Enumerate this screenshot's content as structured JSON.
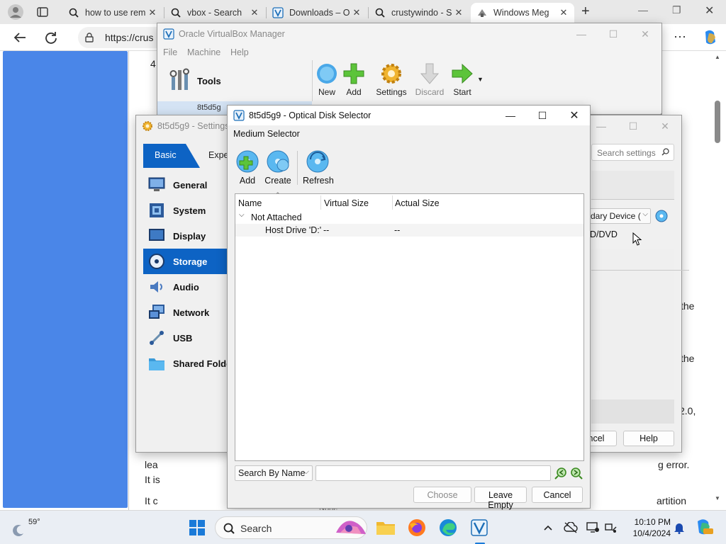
{
  "browser": {
    "tabs": [
      {
        "label": "how to use rem",
        "icon": "search-icon"
      },
      {
        "label": "vbox - Search",
        "icon": "search-icon"
      },
      {
        "label": "Downloads – O",
        "icon": "vbox-icon"
      },
      {
        "label": "crustywindo - S",
        "icon": "search-icon"
      },
      {
        "label": "Windows Meg",
        "icon": "page-icon"
      }
    ],
    "address": "https://crus",
    "new_tab": "+"
  },
  "webpage": {
    "fragments": {
      "top_num": "4",
      "the1": "the",
      "the2": "the",
      "v20": "2.0,",
      "lea": "lea",
      "it_is": "It is",
      "it_c": "It c",
      "g_error": "g error.",
      "artition": "artition",
      "none": "None"
    }
  },
  "vbox_manager": {
    "title": "Oracle VirtualBox Manager",
    "menu": [
      "File",
      "Machine",
      "Help"
    ],
    "tools_label": "Tools",
    "vm_name": "8t5d5g",
    "toolbar": [
      "New",
      "Add",
      "Settings",
      "Discard",
      "Start"
    ]
  },
  "settings": {
    "title": "8t5d5g9 - Settings",
    "tab_basic": "Basic",
    "tab_expert": "Exper",
    "search_placeholder": "Search settings",
    "sections": [
      "General",
      "System",
      "Display",
      "Storage",
      "Audio",
      "Network",
      "USB",
      "Shared Folder"
    ],
    "active_section": "Storage",
    "secondary_device": "dary Device (",
    "optical": "D/DVD",
    "cancel_label": "ncel",
    "help_label": "Help"
  },
  "disk_selector": {
    "title": "8t5d5g9 - Optical Disk Selector",
    "medium_selector": "Medium Selector",
    "toolbar": [
      "Add",
      "Create",
      "Refresh"
    ],
    "columns": [
      "Name",
      "Virtual Size",
      "Actual Size"
    ],
    "group": "Not Attached",
    "rows": [
      {
        "name": "Host Drive 'D:'",
        "virtual_size": "--",
        "actual_size": "--"
      }
    ],
    "search_mode": "Search By Name",
    "search_value": "",
    "buttons": {
      "choose": "Choose",
      "leave_empty": "Leave Empty",
      "cancel": "Cancel"
    }
  },
  "taskbar": {
    "weather_temp": "59°",
    "search_label": "Search",
    "time": "10:10 PM",
    "date": "10/4/2024"
  },
  "colors": {
    "accent": "#0d63c4",
    "page_blue": "#4a86e8"
  }
}
